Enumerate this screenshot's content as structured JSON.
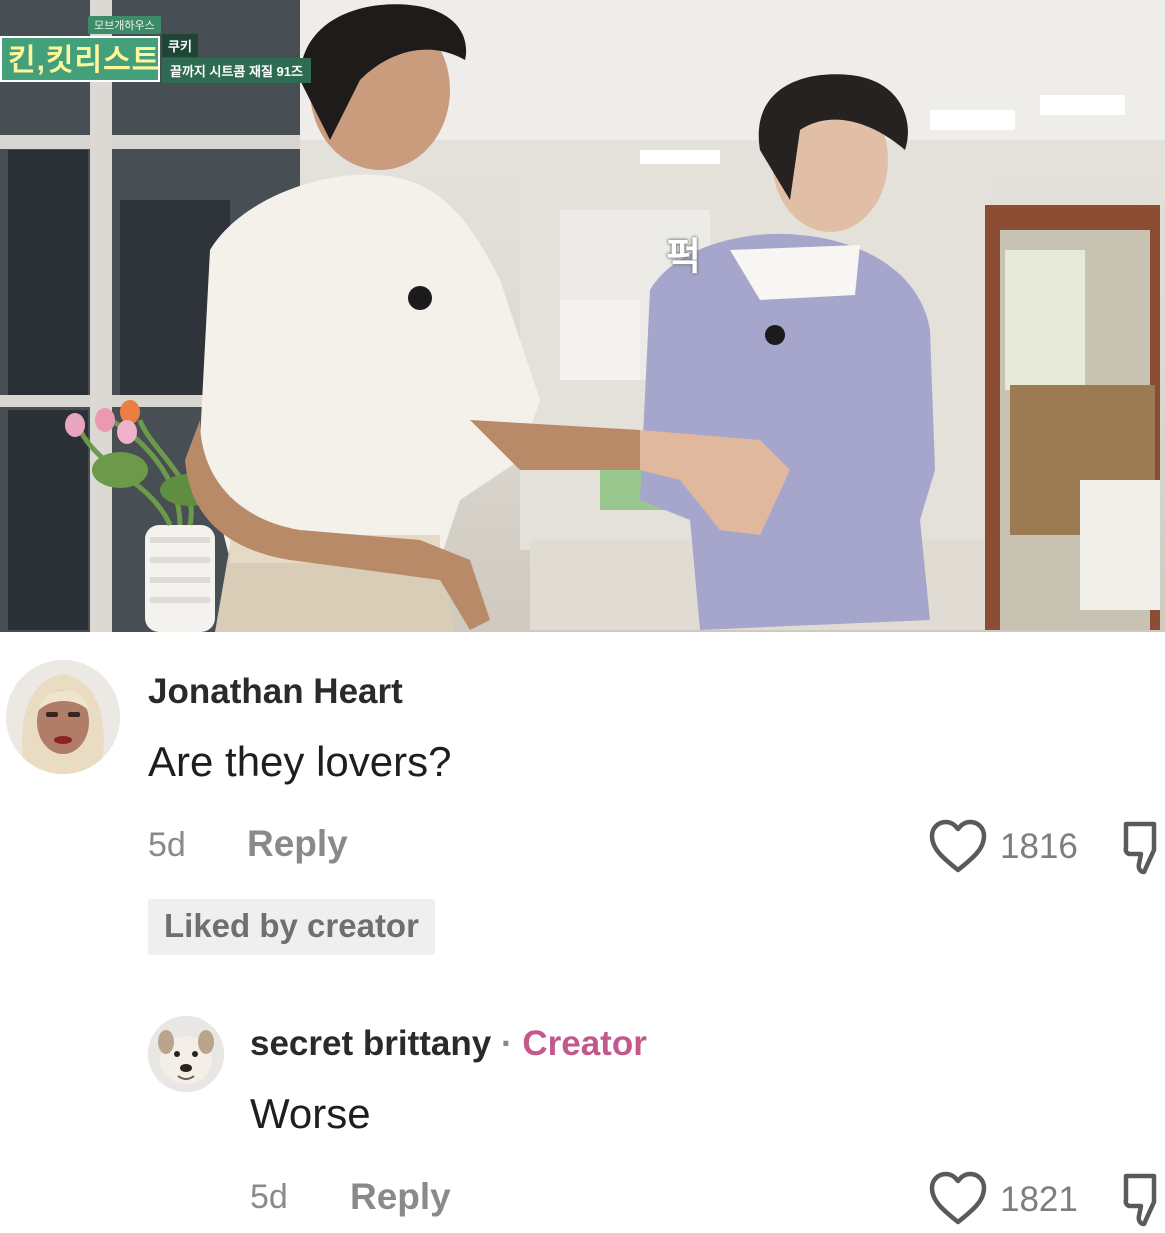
{
  "video": {
    "logo_top": "모브개하우스",
    "show_title": "킨,킷리스트",
    "episode_name": "쿠키",
    "episode_caption": "끝까지 시트콤 재질 91즈",
    "sfx": "퍽"
  },
  "comments": [
    {
      "username": "Jonathan Heart",
      "text": "Are they lovers?",
      "time": "5d",
      "reply_label": "Reply",
      "likes": "1816",
      "liked_by_creator": "Liked by creator",
      "avatar": "woman-blonde-hair-avatar"
    },
    {
      "username": "secret brittany",
      "separator": "·",
      "creator_label": "Creator",
      "text": "Worse",
      "time": "5d",
      "reply_label": "Reply",
      "likes": "1821",
      "avatar": "dog-avatar"
    }
  ],
  "icons": {
    "like": "heart-outline-icon",
    "dislike": "thumbs-down-icon"
  },
  "colors": {
    "creator_tag": "#c2588b",
    "show_green": "#44a07a",
    "meta_gray": "#8a8a8a"
  }
}
